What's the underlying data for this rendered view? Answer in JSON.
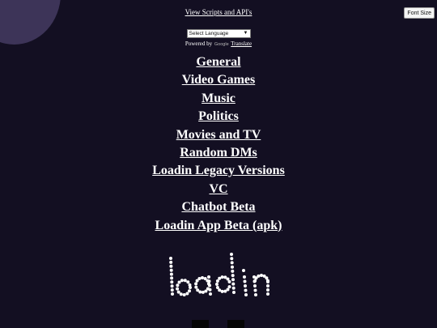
{
  "header": {
    "scripts_link": "View Scripts and API's",
    "font_size_button": "Font Size"
  },
  "translate": {
    "select_value": "Select Language",
    "powered_by": "Powered by",
    "google_logo_text": "Google",
    "translate_link": "Translate"
  },
  "menu": {
    "items": [
      "General",
      "Video Games",
      "Music",
      "Politics",
      "Movies and TV",
      "Random DMs",
      "Loadin Legacy Versions",
      "VC",
      "Chatbot Beta",
      "Loadin App Beta (apk)"
    ]
  },
  "logo": {
    "text": "loadin"
  },
  "colors": {
    "background": "#130f22",
    "blob": "#3d3458",
    "text": "#ffffff"
  }
}
